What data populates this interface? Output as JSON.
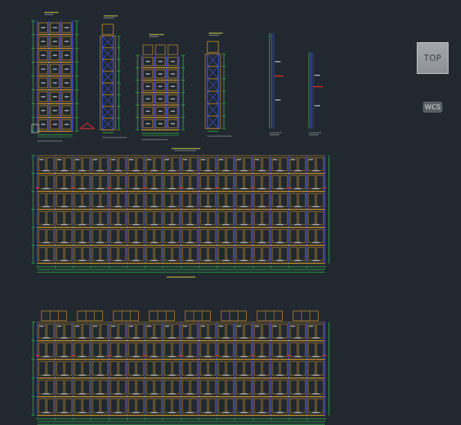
{
  "app": {
    "viewcube_label": "TOP",
    "wcs_label": "WCS"
  },
  "colors": {
    "background": "#212830",
    "upright": "#3d4ce0",
    "beam": "#e6a32a",
    "dimension": "#33d14a",
    "annotation": "#e6e64a",
    "highlight": "#ff2b2b",
    "text": "#d9dce0"
  },
  "drawing": {
    "elevation_views": [
      {
        "id": "front-elevation-1",
        "bays": 3,
        "levels": 8
      },
      {
        "id": "side-elevation-1",
        "levels": 8
      },
      {
        "id": "front-elevation-2",
        "bays": 3,
        "levels": 6
      },
      {
        "id": "side-elevation-2",
        "levels": 6
      },
      {
        "id": "upright-detail-1"
      },
      {
        "id": "upright-detail-2"
      }
    ],
    "plan_views": [
      {
        "id": "long-elevation-1",
        "bays": 16,
        "levels": 6
      },
      {
        "id": "long-elevation-2",
        "bays": 16,
        "levels": 5
      }
    ]
  }
}
